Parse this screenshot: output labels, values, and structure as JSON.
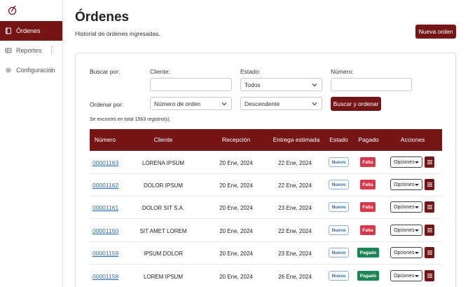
{
  "sidebar": {
    "items": [
      {
        "label": "Órdenes",
        "icon": "book-icon"
      },
      {
        "label": "Reportes",
        "icon": "table-icon"
      },
      {
        "label": "Configuración",
        "icon": "gear-icon"
      }
    ]
  },
  "header": {
    "title": "Órdenes",
    "subtitle": "Historial de órdenes ingresadas.",
    "new_button": "Nueva orden"
  },
  "filters": {
    "search_label": "Buscar por:",
    "cliente_label": "Cliente:",
    "cliente_value": "",
    "estado_label": "Estado:",
    "estado_value": "Todos",
    "numero_label": "Número:",
    "numero_value": "",
    "order_label": "Ordenar por:",
    "order_value": "Número de orden",
    "direction_value": "Descendente",
    "search_button": "Buscar y ordenar",
    "count_text": "Se encontró en total 1563 registro(s)."
  },
  "table": {
    "headers": [
      "Número",
      "Cliente",
      "Recepción",
      "Entrega estimada",
      "Estado",
      "Pagado",
      "Acciones"
    ],
    "options_label": "Opciones",
    "rows": [
      {
        "numero": "00001163",
        "cliente": "LORENA IPSUM",
        "recepcion": "20 Ene, 2024",
        "entrega": "22 Ene, 2024",
        "estado": "Nuevo",
        "pagado": "Falta"
      },
      {
        "numero": "00001162",
        "cliente": "DOLOR IPSUM",
        "recepcion": "20 Ene, 2024",
        "entrega": "22 Ene, 2024",
        "estado": "Nuevo",
        "pagado": "Falta"
      },
      {
        "numero": "00001161",
        "cliente": "DOLOR SIT S.A.",
        "recepcion": "20 Ene, 2024",
        "entrega": "23 Ene, 2024",
        "estado": "Nuevo",
        "pagado": "Falta"
      },
      {
        "numero": "00001160",
        "cliente": "SIT AMET LOREM",
        "recepcion": "20 Ene, 2024",
        "entrega": "22 Ene, 2024",
        "estado": "Nuevo",
        "pagado": "Falta"
      },
      {
        "numero": "00001159",
        "cliente": "IPSUM DOLOR",
        "recepcion": "20 Ene, 2024",
        "entrega": "23 Ene, 2024",
        "estado": "Nuevo",
        "pagado": "Pagado"
      },
      {
        "numero": "00001158",
        "cliente": "LOREM IPSUM",
        "recepcion": "20 Ene, 2024",
        "entrega": "26 Ene, 2024",
        "estado": "Nuevo",
        "pagado": "Pagado"
      }
    ]
  },
  "colors": {
    "brand": "#751515",
    "falta": "#d6394b",
    "pagado": "#198754",
    "link": "#2b6cb0"
  }
}
